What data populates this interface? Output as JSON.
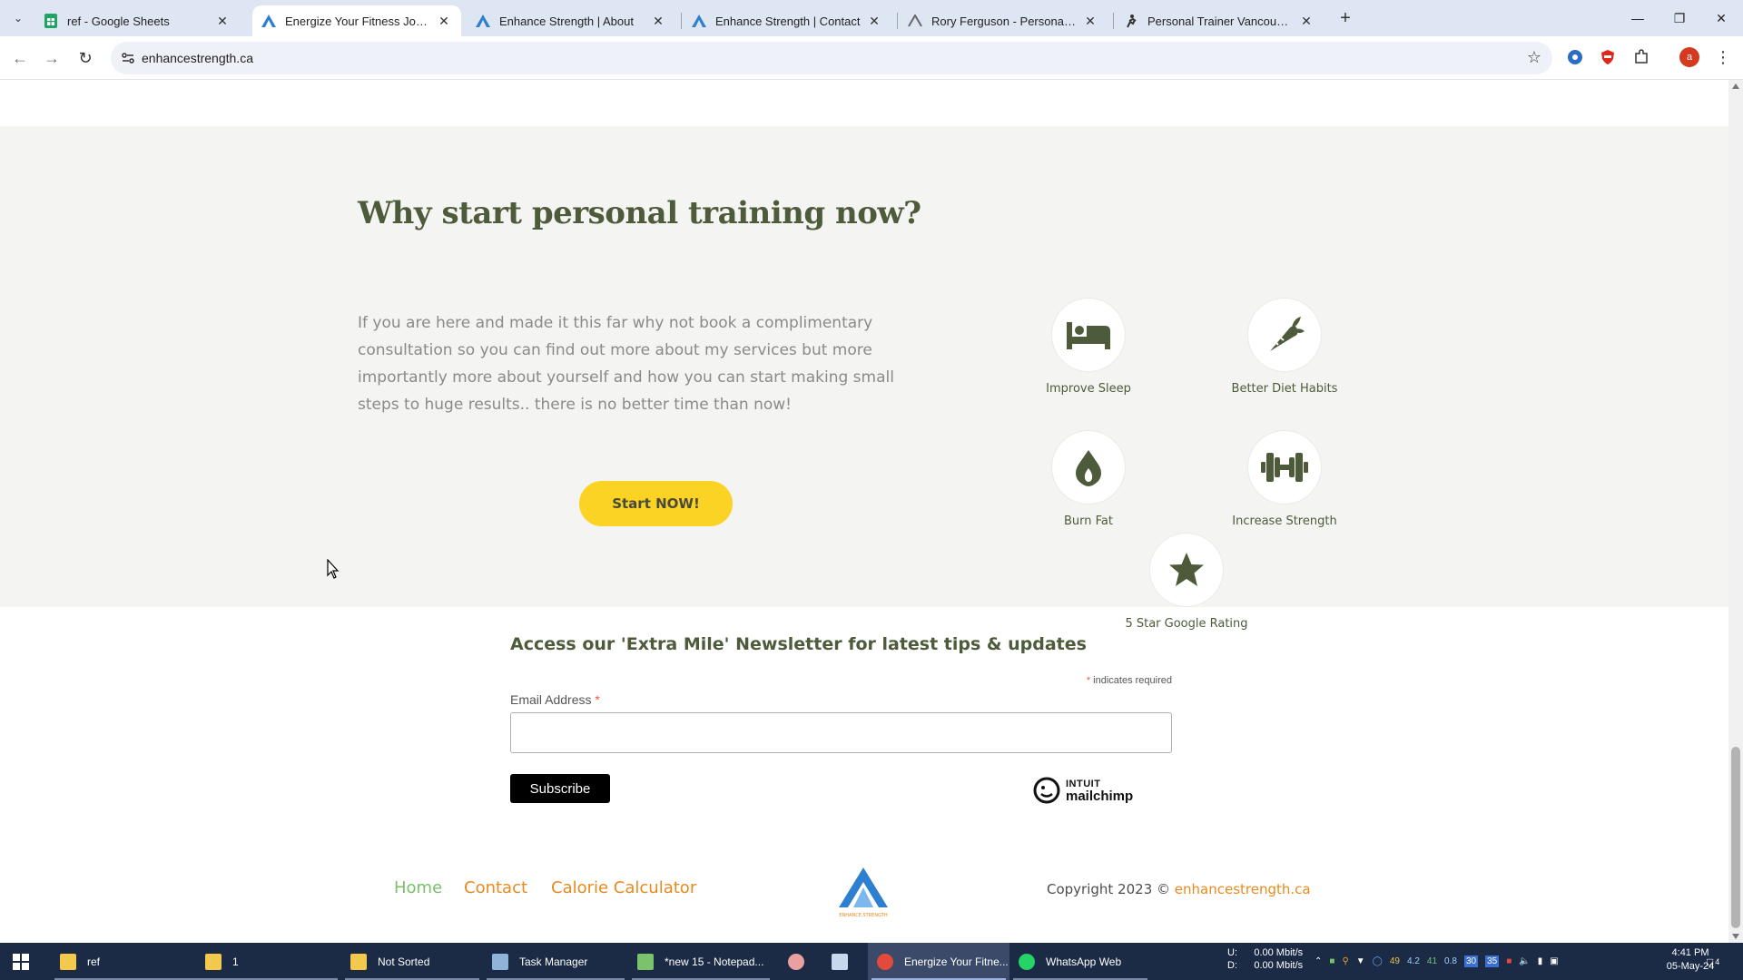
{
  "browser": {
    "tabs": [
      {
        "title": "ref - Google Sheets",
        "icon": "google-sheets-icon",
        "active": false
      },
      {
        "title": "Energize Your Fitness Journey w",
        "icon": "enhance-strength-favicon",
        "active": true
      },
      {
        "title": "Enhance Strength | About",
        "icon": "enhance-strength-favicon",
        "active": false
      },
      {
        "title": "Enhance Strength | Contact",
        "icon": "enhance-strength-favicon",
        "active": false
      },
      {
        "title": "Rory Ferguson - Personal Traini",
        "icon": "rory-favicon",
        "active": false
      },
      {
        "title": "Personal Trainer Vancouver | We",
        "icon": "trainer-favicon",
        "active": false
      }
    ],
    "url": "enhancestrength.ca",
    "profile_initial": "a"
  },
  "why": {
    "title": "Why start personal training now?",
    "text": "If you are here and made it this far why not book a complimentary consultation so you can find out more about my services but more importantly more about yourself and how you can start making small steps to huge results.. there is no better time than now!",
    "cta": "Start NOW!",
    "benefits": [
      {
        "label": "Improve Sleep",
        "icon": "bed-icon"
      },
      {
        "label": "Better Diet Habits",
        "icon": "carrot-icon"
      },
      {
        "label": "Burn Fat",
        "icon": "fire-icon"
      },
      {
        "label": "Increase Strength",
        "icon": "dumbbell-icon"
      },
      {
        "label": "5 Star Google Rating",
        "icon": "star-icon"
      }
    ],
    "accent_color": "#4d5b3b",
    "cta_color": "#fbd324"
  },
  "newsletter": {
    "title": "Access our 'Extra Mile' Newsletter for latest tips & updates",
    "required_note": "indicates required",
    "required_mark": "*",
    "email_label": "Email Address",
    "email_value": "",
    "subscribe": "Subscribe",
    "badge_line1": "INTUIT",
    "badge_line2": "mailchimp"
  },
  "footer": {
    "links": [
      {
        "label": "Home",
        "color": "#7bbf6a"
      },
      {
        "label": "Contact",
        "color": "#e88a1d"
      },
      {
        "label": "Calorie Calculator",
        "color": "#e88a1d"
      }
    ],
    "logo_text": "ENHANCE STRENGTH",
    "copyright_prefix": "Copyright 2023 ©",
    "copyright_site": "enhancestrength.ca"
  },
  "taskbar": {
    "items": [
      {
        "label": "ref",
        "icon": "folder-icon"
      },
      {
        "label": "1",
        "icon": "folder-icon"
      },
      {
        "label": "Not Sorted",
        "icon": "folder-icon"
      },
      {
        "label": "Task Manager",
        "icon": "task-manager-icon"
      },
      {
        "label": "*new 15 - Notepad...",
        "icon": "notepad-icon"
      },
      {
        "label": "Energize Your Fitne...",
        "icon": "chrome-icon"
      },
      {
        "label": "WhatsApp Web",
        "icon": "whatsapp-icon"
      }
    ],
    "net_up_label": "U:",
    "net_up": "0.00 Mbit/s",
    "net_down_label": "D:",
    "net_down": "0.00 Mbit/s",
    "tray_numbers": [
      "49",
      "4.2",
      "41",
      "0.8"
    ],
    "tray_badges": [
      "30",
      "35"
    ],
    "time": "4:41 PM",
    "date": "05-May-24",
    "notification_count": "4"
  }
}
